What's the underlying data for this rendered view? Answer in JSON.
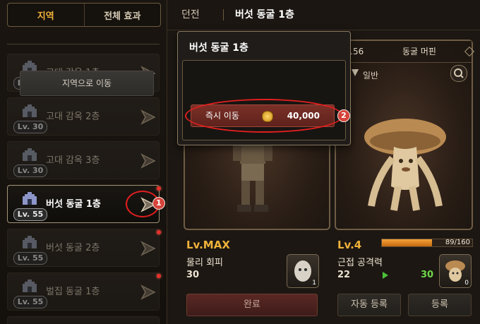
{
  "left_tabs": {
    "region": "지역",
    "all_effects": "전체 효과"
  },
  "regions": [
    {
      "level": "Lv. 30",
      "name": "고대 감옥 1층"
    },
    {
      "level": "Lv. 30",
      "name": "고대 감옥 2층"
    },
    {
      "level": "Lv. 30",
      "name": "고대 감옥 3층"
    },
    {
      "level": "Lv. 55",
      "name": "버섯 동굴 1층"
    },
    {
      "level": "Lv. 55",
      "name": "버섯 동굴 2층"
    },
    {
      "level": "Lv. 55",
      "name": "벌집 동굴 1층"
    }
  ],
  "breadcrumb": {
    "dungeon": "던전",
    "current": "버섯 동굴 1층"
  },
  "popup": {
    "title": "버섯 동굴 1층",
    "move_to_region": "지역으로 이동",
    "instant_move": "즉시 이동",
    "cost": "40,000",
    "annotation_1": "1",
    "annotation_2": "2"
  },
  "left_card": {
    "level": "Lv.MAX",
    "stat_name": "물리 회피",
    "stat_value": "30",
    "item_count": "1",
    "complete_button": "완료"
  },
  "right_card": {
    "header_level": "v.56",
    "header_name": "동굴 머핀",
    "grade": "일반",
    "level": "Lv.4",
    "xp_text": "89/160",
    "xp_current": 89,
    "xp_max": 160,
    "stat_name": "근접 공격력",
    "stat_value": "22",
    "stat_next": "30",
    "item_count": "0",
    "auto_register_button": "자동 등록",
    "register_button": "등록"
  }
}
